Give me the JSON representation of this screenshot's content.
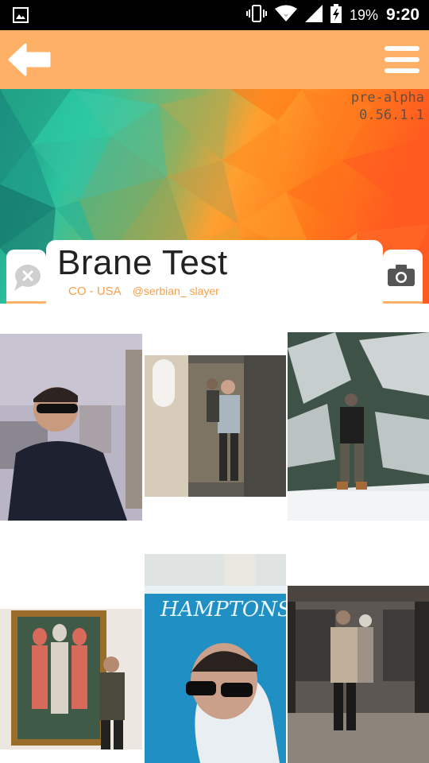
{
  "status_bar": {
    "battery_percent": "19%",
    "time": "9:20",
    "icons": [
      "image-icon",
      "vibrate-icon",
      "wifi-icon",
      "signal-icon",
      "battery-charging-icon"
    ]
  },
  "app_bar": {
    "back_icon": "arrow-left-icon",
    "menu_icon": "hamburger-menu-icon",
    "background_color": "#ffb067"
  },
  "banner": {
    "version_line1": "pre-alpha",
    "version_line2": "0.56.1.1"
  },
  "profile": {
    "name": "Brane Test",
    "location": "CO - USA",
    "handle": "@serbian_ slayer",
    "left_button_icon": "chat-close-icon",
    "right_button_icon": "camera-icon",
    "accent_color": "#f5a04a"
  },
  "photos": [
    {
      "id": "photo-1",
      "subject": "selfie-city-skyline"
    },
    {
      "id": "photo-2",
      "subject": "mirror-selfie-hallway"
    },
    {
      "id": "photo-3",
      "subject": "snowy-pine-trees"
    },
    {
      "id": "photo-4",
      "subject": "museum-painting"
    },
    {
      "id": "photo-5",
      "subject": "hamptons-pool-selfie"
    },
    {
      "id": "photo-6",
      "subject": "store-mirror-selfie"
    }
  ]
}
